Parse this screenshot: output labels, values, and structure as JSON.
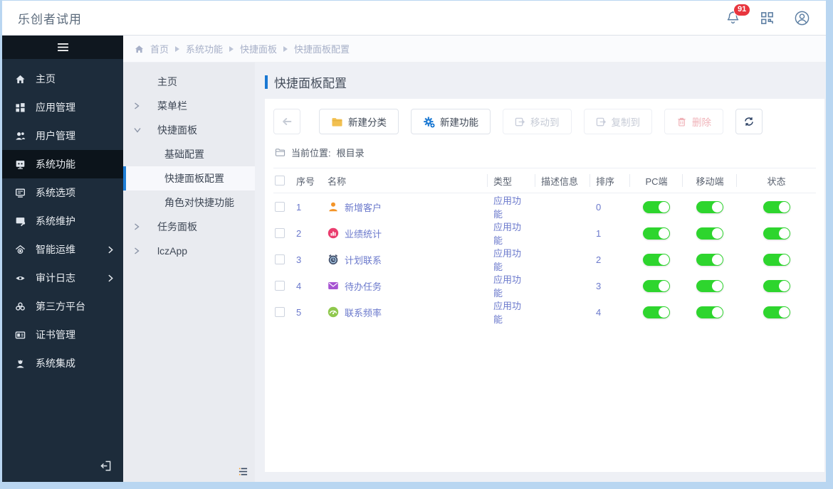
{
  "header": {
    "title": "乐创者试用",
    "notification_count": "91"
  },
  "nav": {
    "items": [
      {
        "label": "主页",
        "icon": "home-icon"
      },
      {
        "label": "应用管理",
        "icon": "apps-icon"
      },
      {
        "label": "用户管理",
        "icon": "users-icon"
      },
      {
        "label": "系统功能",
        "icon": "system-function-icon",
        "active": true
      },
      {
        "label": "系统选项",
        "icon": "system-options-icon"
      },
      {
        "label": "系统维护",
        "icon": "system-maintenance-icon"
      },
      {
        "label": "智能运维",
        "icon": "smart-ops-icon",
        "chevron": true
      },
      {
        "label": "审计日志",
        "icon": "audit-log-icon",
        "chevron": true
      },
      {
        "label": "第三方平台",
        "icon": "third-party-icon"
      },
      {
        "label": "证书管理",
        "icon": "certificate-icon"
      },
      {
        "label": "系统集成",
        "icon": "integration-icon"
      }
    ]
  },
  "submenu": {
    "items": [
      {
        "label": "主页",
        "level": 1,
        "state": "none"
      },
      {
        "label": "菜单栏",
        "level": 1,
        "state": "collapsed"
      },
      {
        "label": "快捷面板",
        "level": 1,
        "state": "expanded"
      },
      {
        "label": "基础配置",
        "level": 2,
        "state": "none"
      },
      {
        "label": "快捷面板配置",
        "level": 2,
        "state": "none",
        "active": true
      },
      {
        "label": "角色对快捷功能",
        "level": 2,
        "state": "none"
      },
      {
        "label": "任务面板",
        "level": 1,
        "state": "collapsed"
      },
      {
        "label": "lczApp",
        "level": 1,
        "state": "collapsed"
      }
    ]
  },
  "breadcrumb": [
    "首页",
    "系统功能",
    "快捷面板",
    "快捷面板配置"
  ],
  "page": {
    "title": "快捷面板配置",
    "toolbar": {
      "new_category": "新建分类",
      "new_function": "新建功能",
      "move_to": "移动到",
      "copy_to": "复制到",
      "delete": "删除"
    },
    "location_label": "当前位置:",
    "location_value": "根目录"
  },
  "table": {
    "columns": [
      "序号",
      "名称",
      "类型",
      "描述信息",
      "排序",
      "PC端",
      "移动端",
      "状态"
    ],
    "rows": [
      {
        "seq": "1",
        "icon": "customer-icon",
        "icon_color": "#f39428",
        "name": "新增客户",
        "type": "应用功能",
        "desc": "",
        "order": "0",
        "pc_on": true,
        "mobile_on": true,
        "status_on": true
      },
      {
        "seq": "2",
        "icon": "stats-icon",
        "icon_color": "#ea3d6e",
        "name": "业绩统计",
        "type": "应用功能",
        "desc": "",
        "order": "1",
        "pc_on": true,
        "mobile_on": true,
        "status_on": true
      },
      {
        "seq": "3",
        "icon": "clock-icon",
        "icon_color": "#46536e",
        "name": "计划联系",
        "type": "应用功能",
        "desc": "",
        "order": "2",
        "pc_on": true,
        "mobile_on": true,
        "status_on": true
      },
      {
        "seq": "4",
        "icon": "mail-icon",
        "icon_color": "#a653d2",
        "name": "待办任务",
        "type": "应用功能",
        "desc": "",
        "order": "3",
        "pc_on": true,
        "mobile_on": true,
        "status_on": true
      },
      {
        "seq": "5",
        "icon": "gauge-icon",
        "icon_color": "#8fc84d",
        "name": "联系频率",
        "type": "应用功能",
        "desc": "",
        "order": "4",
        "pc_on": true,
        "mobile_on": true,
        "status_on": true
      }
    ]
  },
  "colors": {
    "toggle_on": "#2ed52e",
    "accent_blue": "#1a78d2",
    "badge_red": "#e8353e",
    "sidebar_bg": "#1d2c3b"
  }
}
